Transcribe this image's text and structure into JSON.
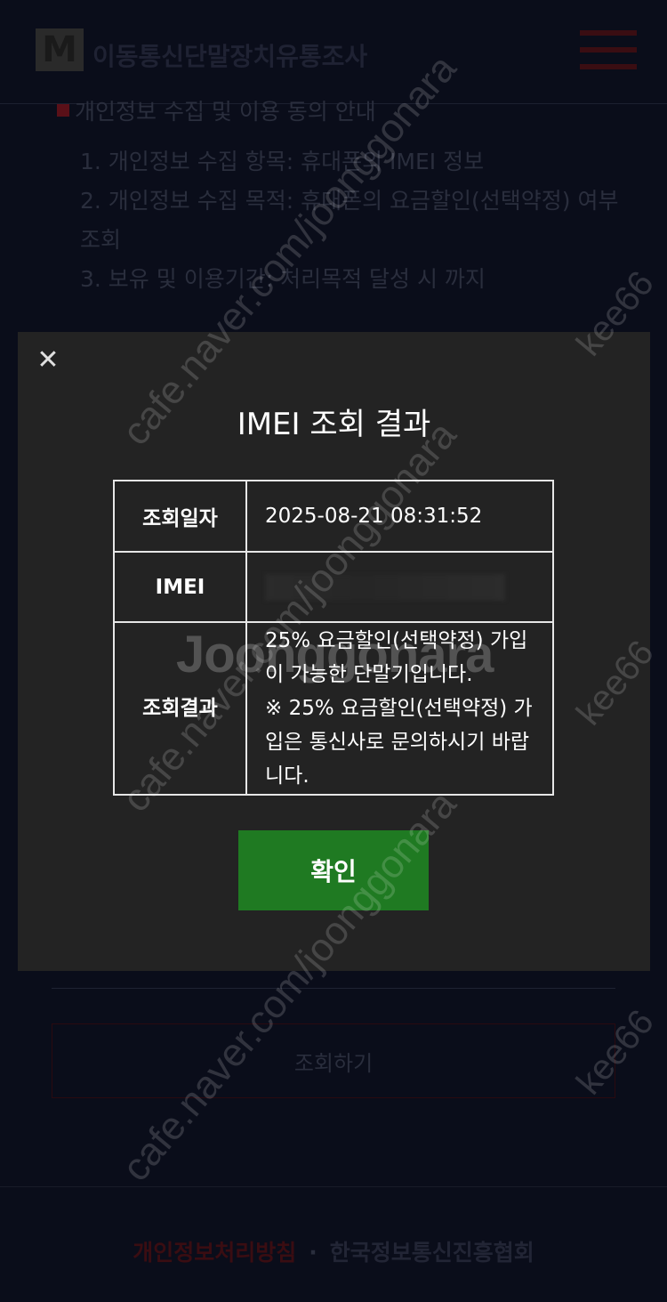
{
  "header": {
    "logo_mark": "M",
    "logo_text": "이동통신단말장치유통조사"
  },
  "notice": {
    "title": "개인정보 수집 및 이용 동의 안내",
    "items": [
      "1. 개인정보 수집 항목: 휴대폰의 IMEI 정보",
      "2. 개인정보 수집 목적: 휴대폰의 요금할인(선택약정) 여부 조회",
      "3. 보유 및 이용기간: 처리목적 달성 시 까지"
    ]
  },
  "modal": {
    "close_glyph": "✕",
    "title": "IMEI 조회 결과",
    "rows": [
      {
        "label": "조회일자",
        "value": "2025-08-21 08:31:52"
      },
      {
        "label": "IMEI",
        "value": ""
      },
      {
        "label": "조회결과",
        "value": "25% 요금할인(선택약정) 가입이 가능한 단말기입니다.\n※ 25% 요금할인(선택약정) 가입은 통신사로 문의하시기 바랍니다."
      }
    ],
    "confirm_label": "확인"
  },
  "query_button": "조회하기",
  "footer": {
    "privacy_link": "개인정보처리방침",
    "separator": "·",
    "org_link": "한국정보통신진흥협회"
  },
  "watermarks": {
    "url": "cafe.naver.com/joonggonara",
    "user": "kee66",
    "brand": "Joonggonara"
  },
  "colors": {
    "page_bg": "#0a0d1a",
    "modal_bg": "#232323",
    "confirm_bg": "#1f7a22",
    "accent_red": "#5a1018"
  },
  "icons": {
    "close": "close-icon",
    "menu": "hamburger-menu-icon"
  }
}
